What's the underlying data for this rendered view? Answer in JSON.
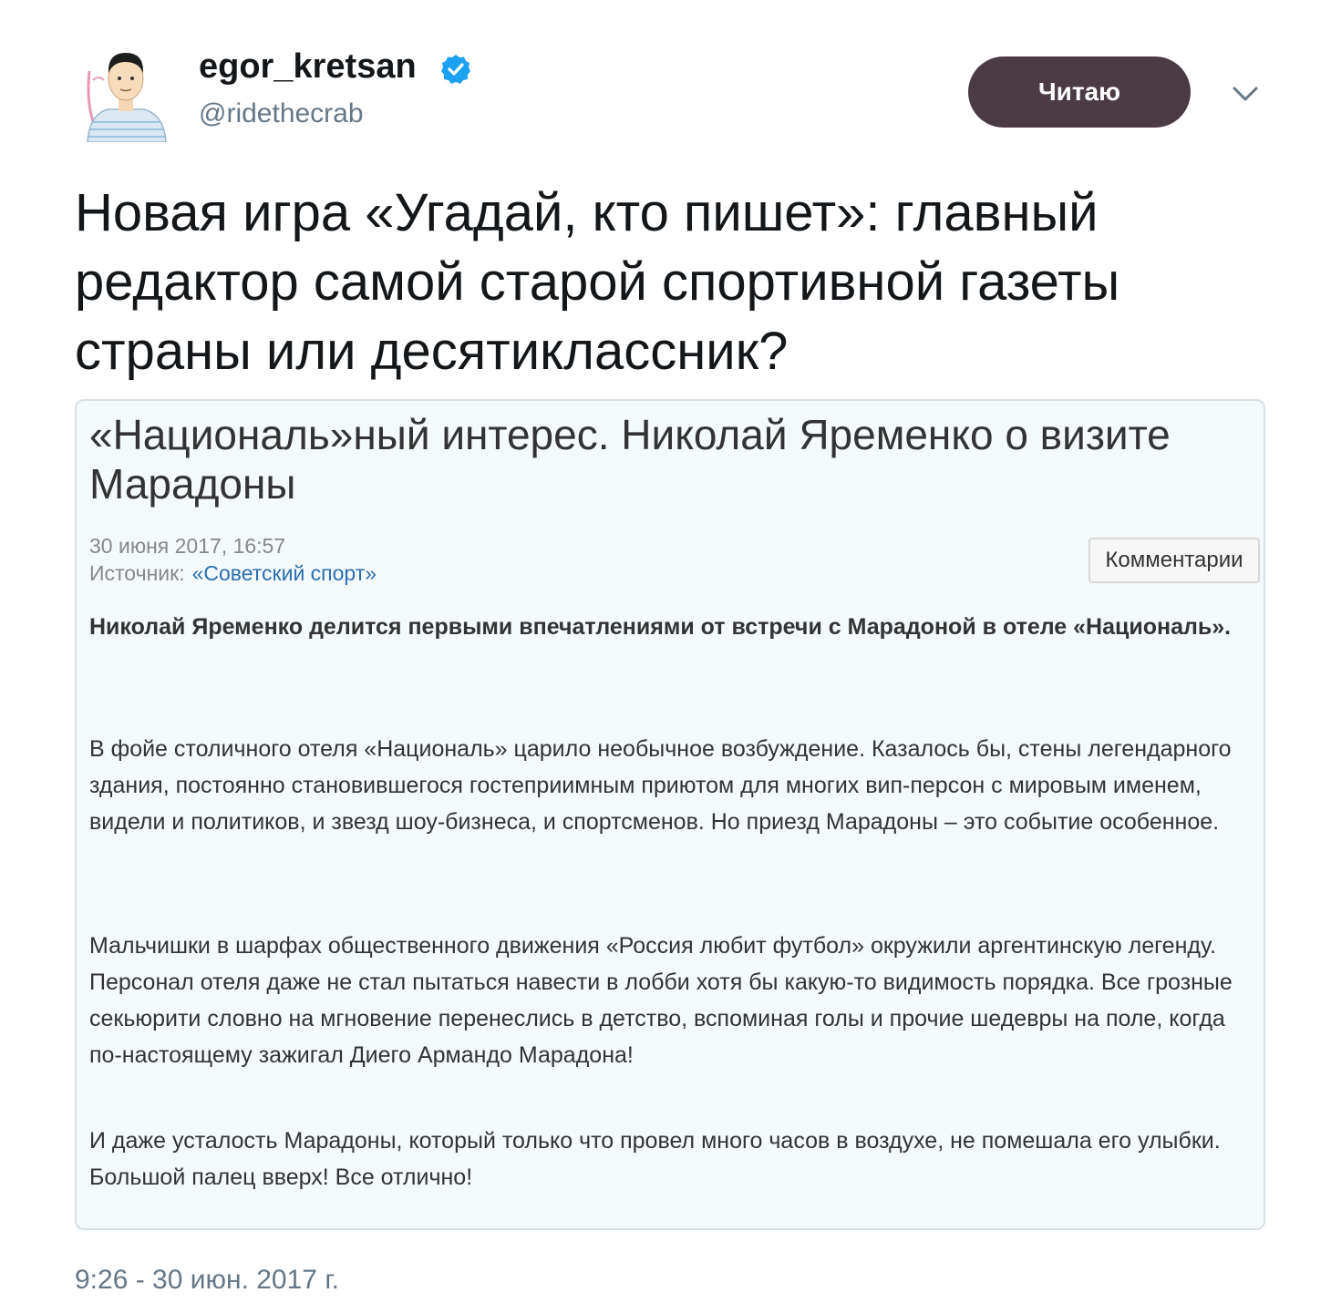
{
  "tweet": {
    "display_name": "egor_kretsan",
    "handle": "@ridethecrab",
    "verified": true,
    "follow_button_label": "Читаю",
    "text": "Новая игра «Угадай, кто пишет»: главный редактор самой старой спортивной газеты страны или десятиклассник?",
    "timestamp": "9:26 - 30 июн. 2017 г."
  },
  "article": {
    "title": "«Националь»ный интерес. Николай Яременко о визите Марадоны",
    "date": "30 июня 2017, 16:57",
    "source_label": "Источник:",
    "source_name": "«Советский спорт»",
    "comments_button_label": "Комментарии",
    "lead": "Николай Яременко делится первыми впечатлениями от встречи с Марадоной в отеле «Националь».",
    "paragraphs": [
      "В фойе столичного отеля «Националь» царило необычное возбуждение. Казалось бы, стены легендарного здания, постоянно становившегося гостеприимным приютом для многих вип-персон с мировым именем, видели и политиков, и звезд шоу-бизнеса, и спортсменов. Но приезд Марадоны – это событие особенное.",
      "Мальчишки в шарфах общественного движения «Россия любит футбол» окружили аргентинскую легенду. Персонал отеля даже не стал пытаться навести в лобби хотя бы какую-то видимость порядка. Все грозные секьюрити словно на мгновение перенеслись в детство, вспоминая голы и прочие шедевры на поле, когда по-настоящему зажигал Диего Армандо Марадона!",
      "И даже усталость Марадоны, который только что провел много часов в воздухе, не помешала его улыбки. Большой палец вверх! Все отлично!"
    ]
  },
  "icons": {
    "verified": "verified-badge-icon",
    "menu": "chevron-down-icon",
    "avatar": "avatar-illustration"
  },
  "colors": {
    "follow_button_bg": "#4a3b44",
    "verified_blue": "#1da1f2",
    "secondary_text": "#657786",
    "card_bg": "#f4f9fc",
    "card_border": "#d7e1e8",
    "link": "#2a6fb0"
  }
}
